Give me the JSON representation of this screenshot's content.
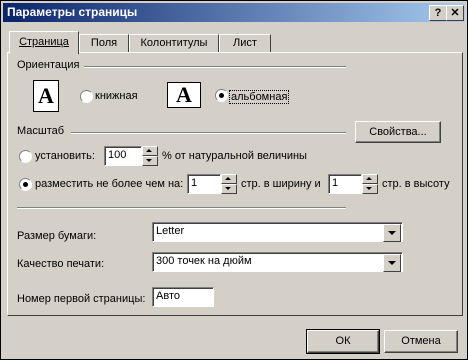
{
  "window": {
    "title": "Параметры страницы",
    "help_label": "?",
    "close_label": "✕"
  },
  "tabs": [
    {
      "label": "Страница"
    },
    {
      "label": "Поля"
    },
    {
      "label": "Колонтитулы"
    },
    {
      "label": "Лист"
    }
  ],
  "orientation": {
    "group_label": "Ориентация",
    "portrait_icon": "A",
    "landscape_icon": "A",
    "portrait_label": "книжная",
    "landscape_label": "альбомная",
    "selected": "landscape"
  },
  "scale": {
    "group_label": "Масштаб",
    "properties_button": "Свойства...",
    "set_label": "установить:",
    "set_value": "100",
    "set_suffix": "% от натуральной величины",
    "fit_label": "разместить не более чем на:",
    "fit_width_value": "1",
    "fit_width_suffix": "стр. в ширину и",
    "fit_height_value": "1",
    "fit_height_suffix": "стр. в высоту",
    "selected": "fit"
  },
  "paper": {
    "size_label": "Размер бумаги:",
    "size_value": "Letter",
    "quality_label": "Качество печати:",
    "quality_value": "300 точек на дюйм",
    "first_page_label": "Номер первой страницы:",
    "first_page_value": "Авто"
  },
  "buttons": {
    "ok": "ОК",
    "cancel": "Отмена"
  }
}
